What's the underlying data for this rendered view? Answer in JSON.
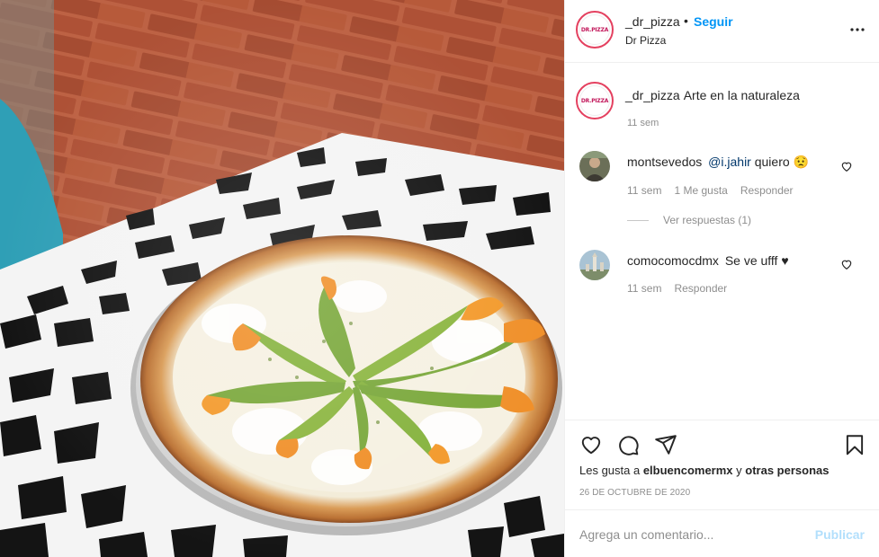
{
  "post": {
    "image_alt": "pizza-photo",
    "header": {
      "avatar_text": "DR.PIZZA",
      "username": "_dr_pizza",
      "separator": "•",
      "follow_label": "Seguir",
      "location": "Dr Pizza",
      "more_icon": "more-horizontal-icon"
    },
    "caption": {
      "username": "_dr_pizza",
      "text": "Arte en la naturaleza",
      "time": "11 sem"
    },
    "comments": [
      {
        "username": "montsevedos",
        "mention": "@i.jahir",
        "text": "quiero",
        "emoji": "😟",
        "time": "11 sem",
        "likes": "1 Me gusta",
        "reply_label": "Responder",
        "view_replies": "Ver respuestas (1)"
      },
      {
        "username": "comocomocdmx",
        "text": "Se ve ufff ♥",
        "time": "11 sem",
        "reply_label": "Responder"
      }
    ],
    "actions": {
      "like_icon": "heart-icon",
      "comment_icon": "comment-icon",
      "share_icon": "send-icon",
      "save_icon": "bookmark-icon"
    },
    "likes": {
      "prefix": "Les gusta a ",
      "user": "elbuencomermx",
      "connector": " y ",
      "others": "otras personas"
    },
    "date": "26 DE OCTUBRE DE 2020",
    "comment_box": {
      "placeholder": "Agrega un comentario...",
      "publish_label": "Publicar"
    }
  },
  "colors": {
    "link_blue": "#0095f6",
    "publish_disabled": "#b2dffc",
    "muted": "#8e8e8e",
    "text": "#262626"
  }
}
